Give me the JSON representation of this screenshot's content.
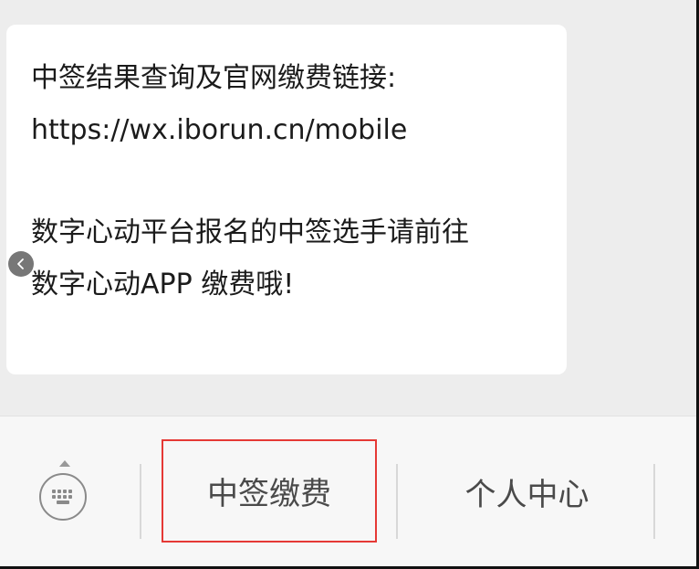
{
  "message": {
    "line1": "中签结果查询及官网缴费链接:",
    "line2": "https://wx.iborun.cn/mobile",
    "line3": "数字心动平台报名的中签选手请前往",
    "line4": "数字心动APP 缴费哦!"
  },
  "menu": {
    "items": [
      {
        "label": "中签缴费"
      },
      {
        "label": "个人中心"
      }
    ]
  },
  "icons": {
    "back": "chevron-left-icon",
    "keyboard": "keyboard-icon"
  },
  "colors": {
    "highlight_border": "#e53935",
    "bubble_bg": "#ffffff",
    "chat_bg": "#ededed",
    "menu_bg": "#f7f7f7"
  }
}
